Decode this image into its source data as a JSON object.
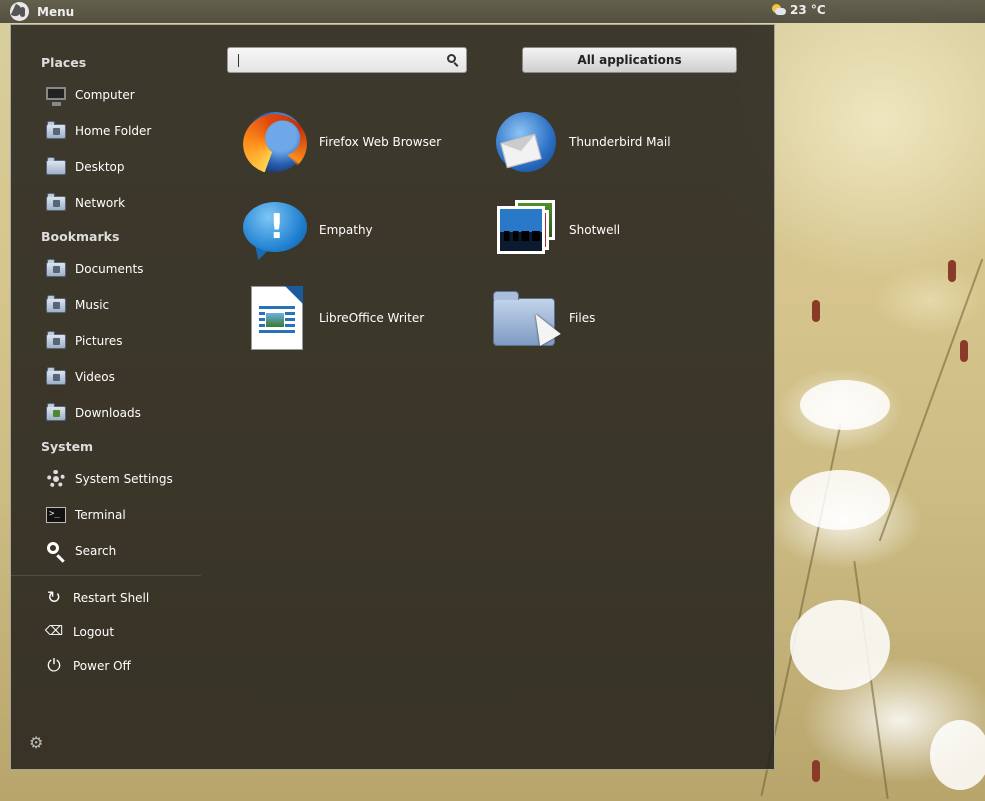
{
  "top_panel": {
    "menu_label": "Menu",
    "weather": "23 °C"
  },
  "menu": {
    "sections": {
      "places": "Places",
      "bookmarks": "Bookmarks",
      "system": "System"
    },
    "places": [
      "Computer",
      "Home Folder",
      "Desktop",
      "Network"
    ],
    "bookmarks": [
      "Documents",
      "Music",
      "Pictures",
      "Videos",
      "Downloads"
    ],
    "system": [
      "System Settings",
      "Terminal",
      "Search"
    ],
    "session": [
      "Restart Shell",
      "Logout",
      "Power Off"
    ],
    "search": {
      "value": "",
      "placeholder": ""
    },
    "all_applications": "All applications",
    "apps": [
      {
        "label": "Firefox Web Browser",
        "icon": "firefox-icon"
      },
      {
        "label": "Thunderbird Mail",
        "icon": "thunderbird-icon"
      },
      {
        "label": "Empathy",
        "icon": "empathy-icon"
      },
      {
        "label": "Shotwell",
        "icon": "shotwell-icon"
      },
      {
        "label": "LibreOffice Writer",
        "icon": "libreoffice-writer-icon"
      },
      {
        "label": "Files",
        "icon": "files-icon"
      }
    ]
  },
  "colors": {
    "panel": "#2f2d27",
    "menu_bg": "#22201a",
    "wallpaper": "#d9cc98"
  }
}
